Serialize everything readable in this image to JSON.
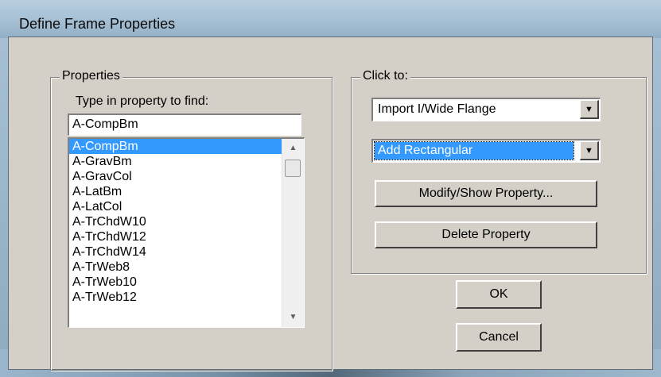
{
  "window": {
    "title": "Define Frame Properties"
  },
  "properties": {
    "group_label": "Properties",
    "find_label": "Type in property to find:",
    "find_value": "A-CompBm",
    "items": [
      "A-CompBm",
      "A-GravBm",
      "A-GravCol",
      "A-LatBm",
      "A-LatCol",
      "A-TrChdW10",
      "A-TrChdW12",
      "A-TrChdW14",
      "A-TrWeb8",
      "A-TrWeb10",
      "A-TrWeb12"
    ],
    "selected": "A-CompBm"
  },
  "actions": {
    "group_label": "Click to:",
    "import_combo": "Import I/Wide Flange",
    "add_combo": "Add Rectangular",
    "modify_button": "Modify/Show Property...",
    "delete_button": "Delete Property"
  },
  "buttons": {
    "ok": "OK",
    "cancel": "Cancel"
  },
  "icons": {
    "scroll_up": "scroll-up-arrow-icon",
    "scroll_down": "scroll-down-arrow-icon",
    "dropdown": "chevron-down-icon"
  }
}
